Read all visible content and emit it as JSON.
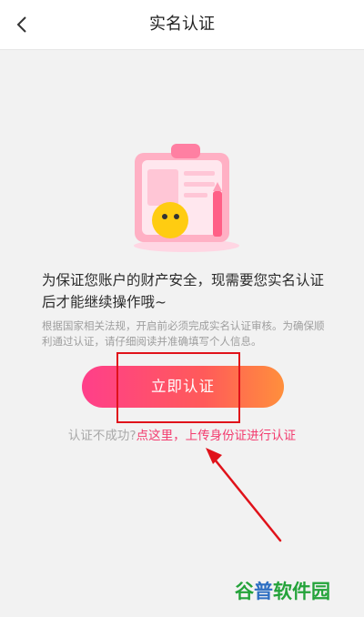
{
  "header": {
    "title": "实名认证",
    "back_icon": "chevron-left-icon"
  },
  "main": {
    "illustration_icon": "clipboard-illustration",
    "message": "为保证您账户的财产安全，现需要您实名认证后才能继续操作哦~",
    "notice": "根据国家相关法规，开启前必须完成实名认证审核。为确保顺利通过认证，请仔细阅读并准确填写个人信息。",
    "verify_button": "立即认证",
    "fail_prefix": "认证不成功?",
    "fail_link": "点这里，上传身份证进行认证"
  },
  "annotation": {
    "highlight_color": "#e0121a",
    "arrow_color": "#e0121a"
  },
  "watermark": {
    "part1": "谷",
    "part2": "普",
    "part3": "软件园"
  },
  "colors": {
    "button_gradient_start": "#ff3f8a",
    "button_gradient_end": "#ff8f3c",
    "link": "#f33c6f"
  }
}
